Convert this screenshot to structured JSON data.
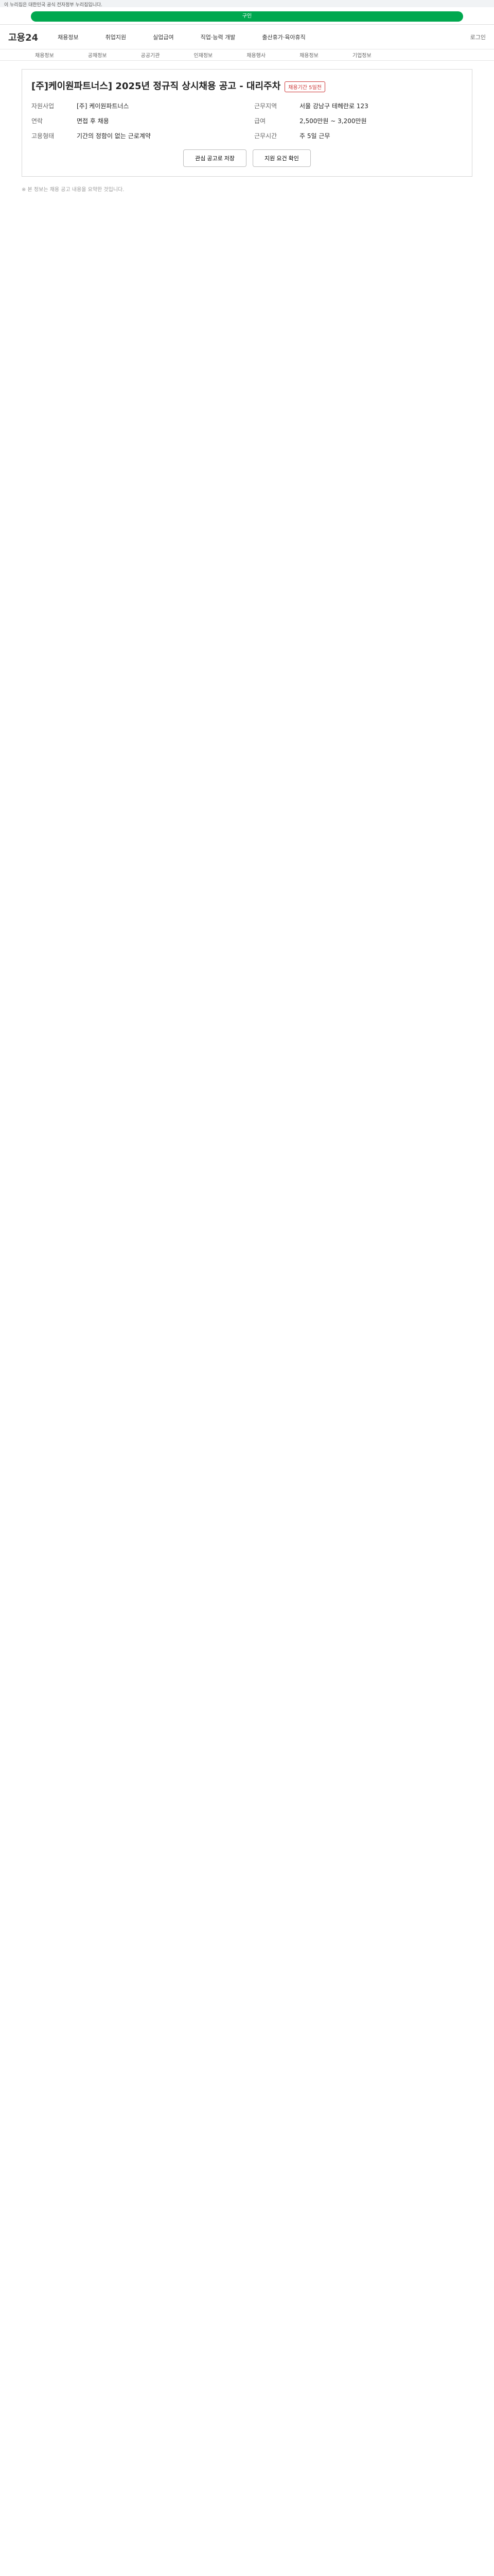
{
  "gov_notice": "이 누리집은 대한민국 공식 전자정부 누리집입니다.",
  "tab_label": "구인",
  "header": {
    "logo": "고용24",
    "menu": [
      "채용정보",
      "취업지원",
      "실업급여",
      "직업·능력 개발",
      "출산휴가·육아휴직"
    ],
    "right": "로그인"
  },
  "subnav": [
    "채용정보",
    "공채정보",
    "공공기관",
    "인재정보",
    "채용행사",
    "채용정보",
    "기업정보"
  ],
  "job": {
    "title": "[주]케이원파트너스] 2025년 정규직 상시채용 공고 - 대리주차",
    "badge": "채용기간 5일전",
    "rows": [
      [
        "자원사업",
        "[주] 케이원파트너스"
      ],
      [
        "근무지역",
        "서울 강남구 테헤란로 123"
      ],
      [
        "연락",
        "면접 후 채용"
      ],
      [
        "급여",
        "2,500만원 ~ 3,200만원"
      ],
      [
        "고용형태",
        "기간의 정함이 없는 근로계약"
      ],
      [
        "근무시간",
        "주 5일 근무"
      ]
    ]
  },
  "actions": [
    "관심 공고로 저장",
    "지원 요건 확인"
  ],
  "footnote": "※ 본 정보는 채용 공고 내용을 요약한 것입니다."
}
